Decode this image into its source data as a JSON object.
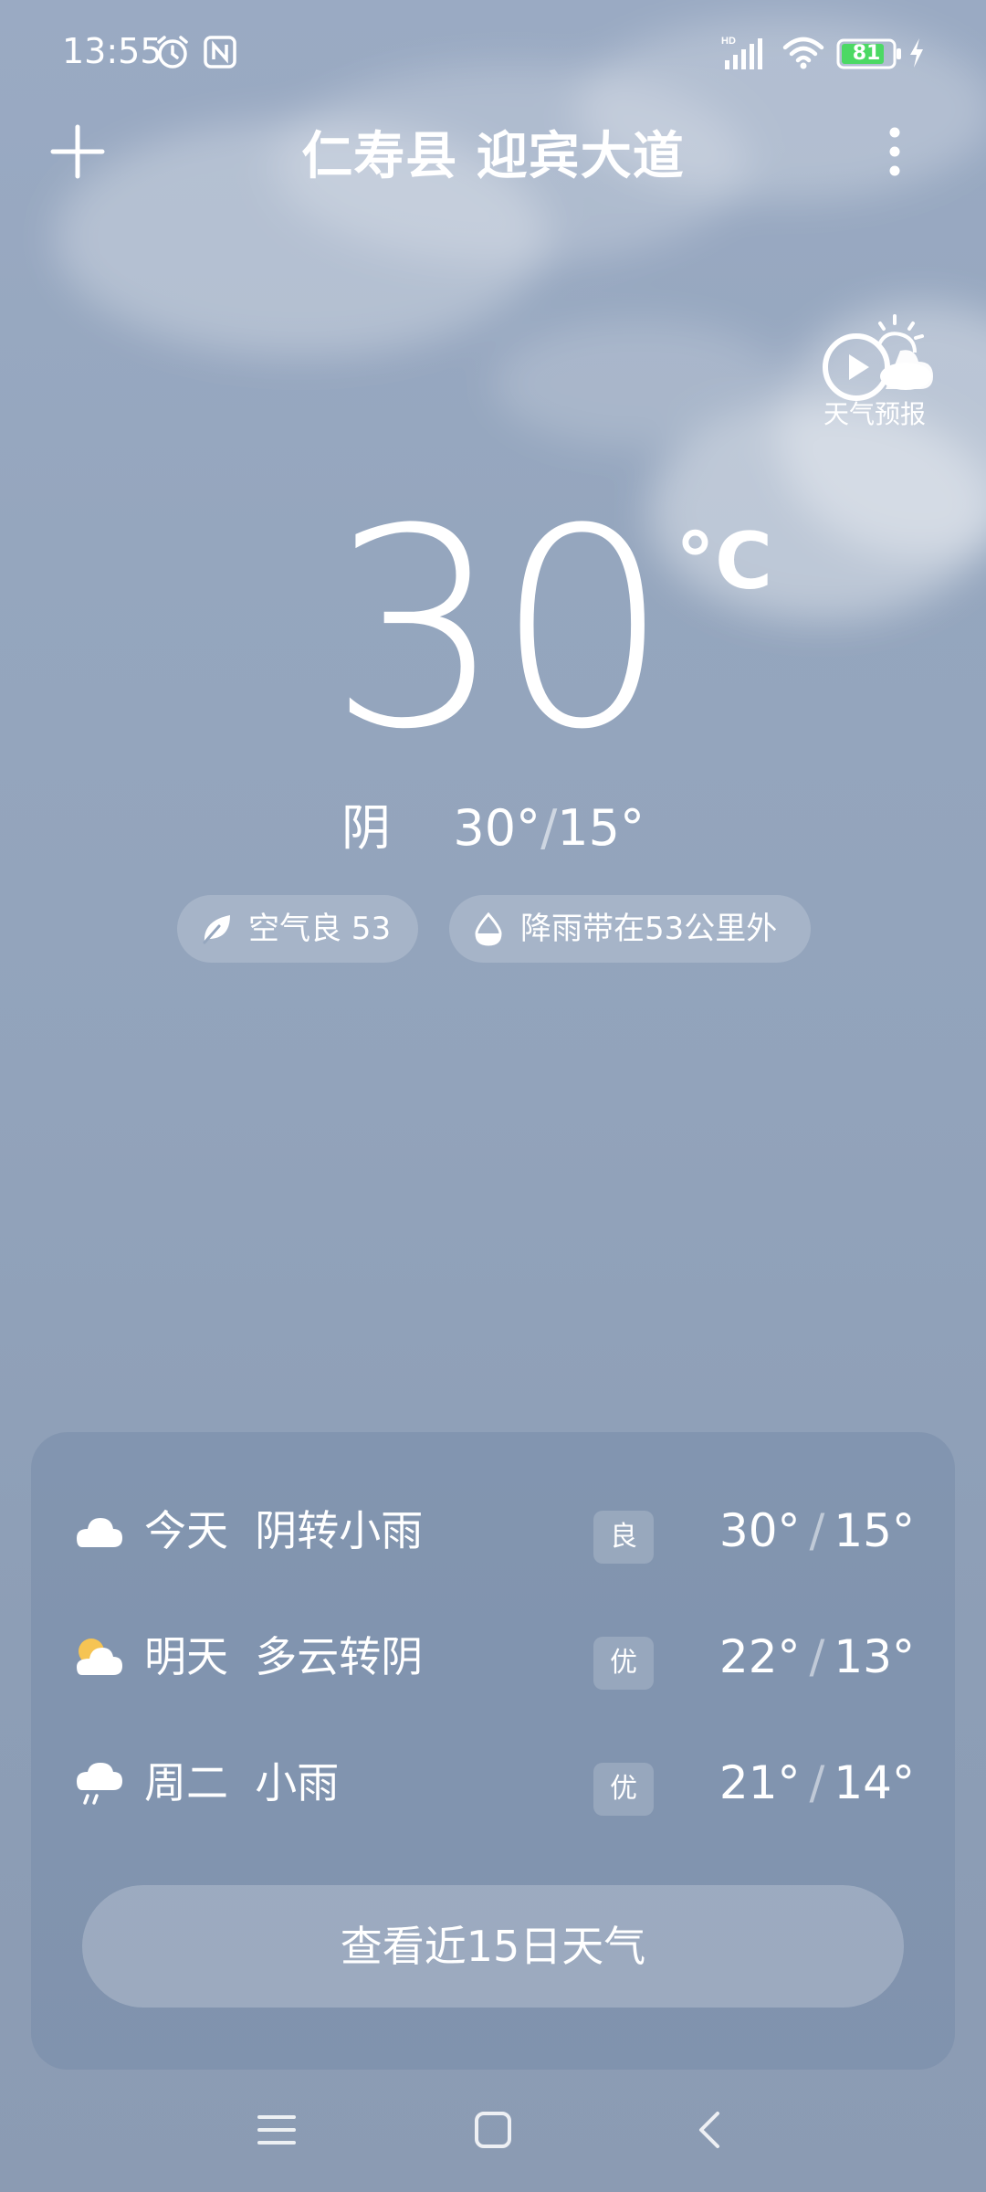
{
  "status_bar": {
    "time": "13:55",
    "battery_level": "81",
    "icons": [
      "alarm-icon",
      "nfc-icon",
      "hd-signal-icon",
      "wifi-icon",
      "battery-icon",
      "charging-icon"
    ]
  },
  "header": {
    "location": "仁寿县 迎宾大道",
    "add_icon": "plus-icon",
    "more_icon": "more-vertical-icon"
  },
  "forecast_video": {
    "label": "天气预报",
    "icon": "play-cloud-icon"
  },
  "current": {
    "temperature": "30",
    "unit": "°C",
    "condition": "阴",
    "high": "30°",
    "low": "15°",
    "separator": "/"
  },
  "chips": {
    "air": {
      "icon": "leaf-icon",
      "text": "空气良 53"
    },
    "rain": {
      "icon": "raindrop-icon",
      "text": "降雨带在53公里外"
    }
  },
  "daily": [
    {
      "icon": "cloud-icon",
      "day": "今天",
      "desc": "阴转小雨",
      "aqi": "良",
      "high": "30°",
      "low": "15°"
    },
    {
      "icon": "partly-cloudy-icon",
      "day": "明天",
      "desc": "多云转阴",
      "aqi": "优",
      "high": "22°",
      "low": "13°"
    },
    {
      "icon": "light-rain-icon",
      "day": "周二",
      "desc": "小雨",
      "aqi": "优",
      "high": "21°",
      "low": "14°"
    }
  ],
  "cta_label": "查看近15日天气",
  "colors": {
    "background_top": "#9aaac3",
    "background_bottom": "#8b9bb3",
    "battery_fill": "#4cd964",
    "sun_accent": "#f6c453"
  }
}
